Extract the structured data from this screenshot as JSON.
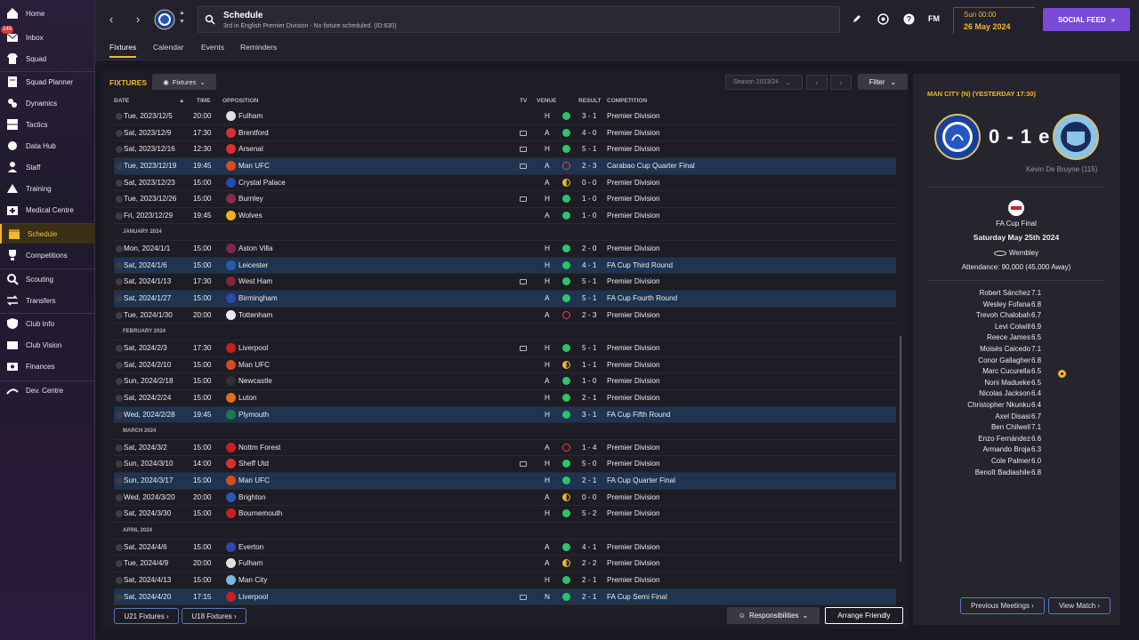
{
  "sidebar": {
    "inbox_badge": "149",
    "items": [
      {
        "label": "Home",
        "icon": "home-icon"
      },
      {
        "label": "Inbox",
        "icon": "inbox-icon"
      },
      {
        "label": "Squad",
        "icon": "shirt-icon"
      },
      {
        "label": "Squad Planner",
        "icon": "planner-icon"
      },
      {
        "label": "Dynamics",
        "icon": "dynamics-icon"
      },
      {
        "label": "Tactics",
        "icon": "tactics-icon"
      },
      {
        "label": "Data Hub",
        "icon": "data-hub-icon"
      },
      {
        "label": "Staff",
        "icon": "staff-icon"
      },
      {
        "label": "Training",
        "icon": "training-icon"
      },
      {
        "label": "Medical Centre",
        "icon": "medical-icon"
      },
      {
        "label": "Schedule",
        "icon": "calendar-icon"
      },
      {
        "label": "Competitions",
        "icon": "trophy-icon"
      },
      {
        "label": "Scouting",
        "icon": "scouting-icon"
      },
      {
        "label": "Transfers",
        "icon": "transfers-icon"
      },
      {
        "label": "Club Info",
        "icon": "shield-icon"
      },
      {
        "label": "Club Vision",
        "icon": "vision-icon"
      },
      {
        "label": "Finances",
        "icon": "finances-icon"
      },
      {
        "label": "Dev. Centre",
        "icon": "dev-centre-icon"
      }
    ]
  },
  "topbar": {
    "title": "Schedule",
    "subtitle": "3rd in English Premier Division - No fixture scheduled. (ID:630)",
    "fm": "FM",
    "date_line1": "Sun 00:00",
    "date_line2": "26 May 2024",
    "social_feed": "SOCIAL FEED"
  },
  "tabs": [
    "Fixtures",
    "Calendar",
    "Events",
    "Reminders"
  ],
  "fixtures": {
    "title": "FIXTURES",
    "view_dropdown": "Fixtures",
    "season": "Season 2023/24",
    "filter": "Filter",
    "headers": {
      "date": "DATE",
      "time": "TIME",
      "opposition": "OPPOSITION",
      "tv": "TV",
      "venue": "VENUE",
      "result": "RESULT",
      "competition": "COMPETITION"
    },
    "rows": [
      {
        "date": "Tue, 2023/12/5",
        "time": "20:00",
        "opp": "Fulham",
        "crest": "#e0e0e0",
        "tv": false,
        "venue": "H",
        "res": "W",
        "score": "3 - 1",
        "comp": "Premier Division",
        "hl": false
      },
      {
        "date": "Sat, 2023/12/9",
        "time": "17:30",
        "opp": "Brentford",
        "crest": "#d83030",
        "tv": true,
        "venue": "A",
        "res": "W",
        "score": "4 - 0",
        "comp": "Premier Division",
        "hl": false
      },
      {
        "date": "Sat, 2023/12/16",
        "time": "12:30",
        "opp": "Arsenal",
        "crest": "#d83030",
        "tv": true,
        "venue": "H",
        "res": "W",
        "score": "5 - 1",
        "comp": "Premier Division",
        "hl": false
      },
      {
        "date": "Tue, 2023/12/19",
        "time": "19:45",
        "opp": "Man UFC",
        "crest": "#d84a20",
        "tv": true,
        "venue": "A",
        "res": "L",
        "score": "2 - 3",
        "comp": "Carabao Cup Quarter Final",
        "hl": true
      },
      {
        "date": "Sat, 2023/12/23",
        "time": "15:00",
        "opp": "Crystal Palace",
        "crest": "#2a4ab0",
        "tv": false,
        "venue": "A",
        "res": "D",
        "score": "0 - 0",
        "comp": "Premier Division",
        "hl": false
      },
      {
        "date": "Tue, 2023/12/26",
        "time": "15:00",
        "opp": "Burnley",
        "crest": "#8a2a4a",
        "tv": true,
        "venue": "H",
        "res": "W",
        "score": "1 - 0",
        "comp": "Premier Division",
        "hl": false
      },
      {
        "date": "Fri, 2023/12/29",
        "time": "19:45",
        "opp": "Wolves",
        "crest": "#f0b020",
        "tv": false,
        "venue": "A",
        "res": "W",
        "score": "1 - 0",
        "comp": "Premier Division",
        "hl": false
      },
      {
        "month": "JANUARY 2024"
      },
      {
        "date": "Mon, 2024/1/1",
        "time": "15:00",
        "opp": "Aston Villa",
        "crest": "#7a2a4a",
        "tv": false,
        "venue": "H",
        "res": "W",
        "score": "2 - 0",
        "comp": "Premier Division",
        "hl": false
      },
      {
        "date": "Sat, 2024/1/6",
        "time": "15:00",
        "opp": "Leicester",
        "crest": "#2a5ab0",
        "tv": false,
        "venue": "H",
        "res": "W",
        "score": "4 - 1",
        "comp": "FA Cup Third Round",
        "hl": true
      },
      {
        "date": "Sat, 2024/1/13",
        "time": "17:30",
        "opp": "West Ham",
        "crest": "#7a2a3a",
        "tv": true,
        "venue": "H",
        "res": "W",
        "score": "5 - 1",
        "comp": "Premier Division",
        "hl": false
      },
      {
        "date": "Sat, 2024/1/27",
        "time": "15:00",
        "opp": "Birmingham",
        "crest": "#2a4ab0",
        "tv": false,
        "venue": "A",
        "res": "W",
        "score": "5 - 1",
        "comp": "FA Cup Fourth Round",
        "hl": true
      },
      {
        "date": "Tue, 2024/1/30",
        "time": "20:00",
        "opp": "Tottenham",
        "crest": "#e8e8f0",
        "tv": false,
        "venue": "A",
        "res": "L",
        "score": "2 - 3",
        "comp": "Premier Division",
        "hl": false
      },
      {
        "month": "FEBRUARY 2024"
      },
      {
        "date": "Sat, 2024/2/3",
        "time": "17:30",
        "opp": "Liverpool",
        "crest": "#c82020",
        "tv": true,
        "venue": "H",
        "res": "W",
        "score": "5 - 1",
        "comp": "Premier Division",
        "hl": false
      },
      {
        "date": "Sat, 2024/2/10",
        "time": "15:00",
        "opp": "Man UFC",
        "crest": "#d84a20",
        "tv": false,
        "venue": "H",
        "res": "D",
        "score": "1 - 1",
        "comp": "Premier Division",
        "hl": false
      },
      {
        "date": "Sun, 2024/2/18",
        "time": "15:00",
        "opp": "Newcastle",
        "crest": "#303030",
        "tv": false,
        "venue": "A",
        "res": "W",
        "score": "1 - 0",
        "comp": "Premier Division",
        "hl": false
      },
      {
        "date": "Sat, 2024/2/24",
        "time": "15:00",
        "opp": "Luton",
        "crest": "#e07020",
        "tv": false,
        "venue": "H",
        "res": "W",
        "score": "2 - 1",
        "comp": "Premier Division",
        "hl": false
      },
      {
        "date": "Wed, 2024/2/28",
        "time": "19:45",
        "opp": "Plymouth",
        "crest": "#207a4a",
        "tv": false,
        "venue": "H",
        "res": "W",
        "score": "3 - 1",
        "comp": "FA Cup Fifth Round",
        "hl": true
      },
      {
        "month": "MARCH 2024"
      },
      {
        "date": "Sat, 2024/3/2",
        "time": "15:00",
        "opp": "Nottm Forest",
        "crest": "#c82020",
        "tv": false,
        "venue": "A",
        "res": "L",
        "score": "1 - 4",
        "comp": "Premier Division",
        "hl": false
      },
      {
        "date": "Sun, 2024/3/10",
        "time": "14:00",
        "opp": "Sheff Utd",
        "crest": "#d83030",
        "tv": true,
        "venue": "H",
        "res": "W",
        "score": "5 - 0",
        "comp": "Premier Division",
        "hl": false
      },
      {
        "date": "Sun, 2024/3/17",
        "time": "15:00",
        "opp": "Man UFC",
        "crest": "#d84a20",
        "tv": false,
        "venue": "H",
        "res": "W",
        "score": "2 - 1",
        "comp": "FA Cup Quarter Final",
        "hl": true
      },
      {
        "date": "Wed, 2024/3/20",
        "time": "20:00",
        "opp": "Brighton",
        "crest": "#2a5ab0",
        "tv": false,
        "venue": "A",
        "res": "D",
        "score": "0 - 0",
        "comp": "Premier Division",
        "hl": false
      },
      {
        "date": "Sat, 2024/3/30",
        "time": "15:00",
        "opp": "Bournemouth",
        "crest": "#c82020",
        "tv": false,
        "venue": "H",
        "res": "W",
        "score": "5 - 2",
        "comp": "Premier Division",
        "hl": false
      },
      {
        "month": "APRIL 2024"
      },
      {
        "date": "Sat, 2024/4/6",
        "time": "15:00",
        "opp": "Everton",
        "crest": "#2a4ab0",
        "tv": false,
        "venue": "A",
        "res": "W",
        "score": "4 - 1",
        "comp": "Premier Division",
        "hl": false
      },
      {
        "date": "Tue, 2024/4/9",
        "time": "20:00",
        "opp": "Fulham",
        "crest": "#e0e0e0",
        "tv": false,
        "venue": "A",
        "res": "D",
        "score": "2 - 2",
        "comp": "Premier Division",
        "hl": false
      },
      {
        "date": "Sat, 2024/4/13",
        "time": "15:00",
        "opp": "Man City",
        "crest": "#7ab8e0",
        "tv": false,
        "venue": "H",
        "res": "W",
        "score": "2 - 1",
        "comp": "Premier Division",
        "hl": false
      },
      {
        "date": "Sat, 2024/4/20",
        "time": "17:15",
        "opp": "Liverpool",
        "crest": "#c82020",
        "tv": true,
        "venue": "N",
        "res": "W",
        "score": "2 - 1",
        "comp": "FA Cup Semi Final",
        "hl": true
      }
    ],
    "btn_u21": "U21 Fixtures",
    "btn_u18": "U18 Fixtures",
    "btn_responsibilities": "Responsibilities",
    "btn_arrange": "Arrange Friendly"
  },
  "match_panel": {
    "title": "MAN CITY (N) (YESTERDAY 17:30)",
    "score": "0 - 1 e",
    "scorer": "Kevin De Bruyne (115)",
    "competition": "FA Cup Final",
    "date": "Saturday May 25th 2024",
    "stadium": "Wembley",
    "attendance": "Attendance: 90,000 (45,000 Away)",
    "lineup": [
      {
        "name": "Robert Sánchez",
        "rating": "7.1"
      },
      {
        "name": "Wesley Fofana",
        "rating": "6.8"
      },
      {
        "name": "Trevoh Chalobah",
        "rating": "6.7"
      },
      {
        "name": "Levi Colwill",
        "rating": "6.9"
      },
      {
        "name": "Reece James",
        "rating": "6.5"
      },
      {
        "name": "Moisés Caicedo",
        "rating": "7.1"
      },
      {
        "name": "Conor Gallagher",
        "rating": "6.8"
      },
      {
        "name": "Marc Cucurella",
        "rating": "6.5"
      },
      {
        "name": "Noni Madueke",
        "rating": "6.5"
      },
      {
        "name": "Nicolas Jackson",
        "rating": "6.4"
      },
      {
        "name": "Christopher Nkunku",
        "rating": "6.4"
      },
      {
        "name": "Axel Disasi",
        "rating": "6.7"
      },
      {
        "name": "Ben Chilwell",
        "rating": "7.1"
      },
      {
        "name": "Enzo Fernández",
        "rating": "6.6"
      },
      {
        "name": "Armando Broja",
        "rating": "6.3"
      },
      {
        "name": "Cole Palmer",
        "rating": "6.0"
      },
      {
        "name": "Benoît Badiashile",
        "rating": "6.8"
      }
    ],
    "btn_previous": "Previous Meetings",
    "btn_view": "View Match"
  }
}
